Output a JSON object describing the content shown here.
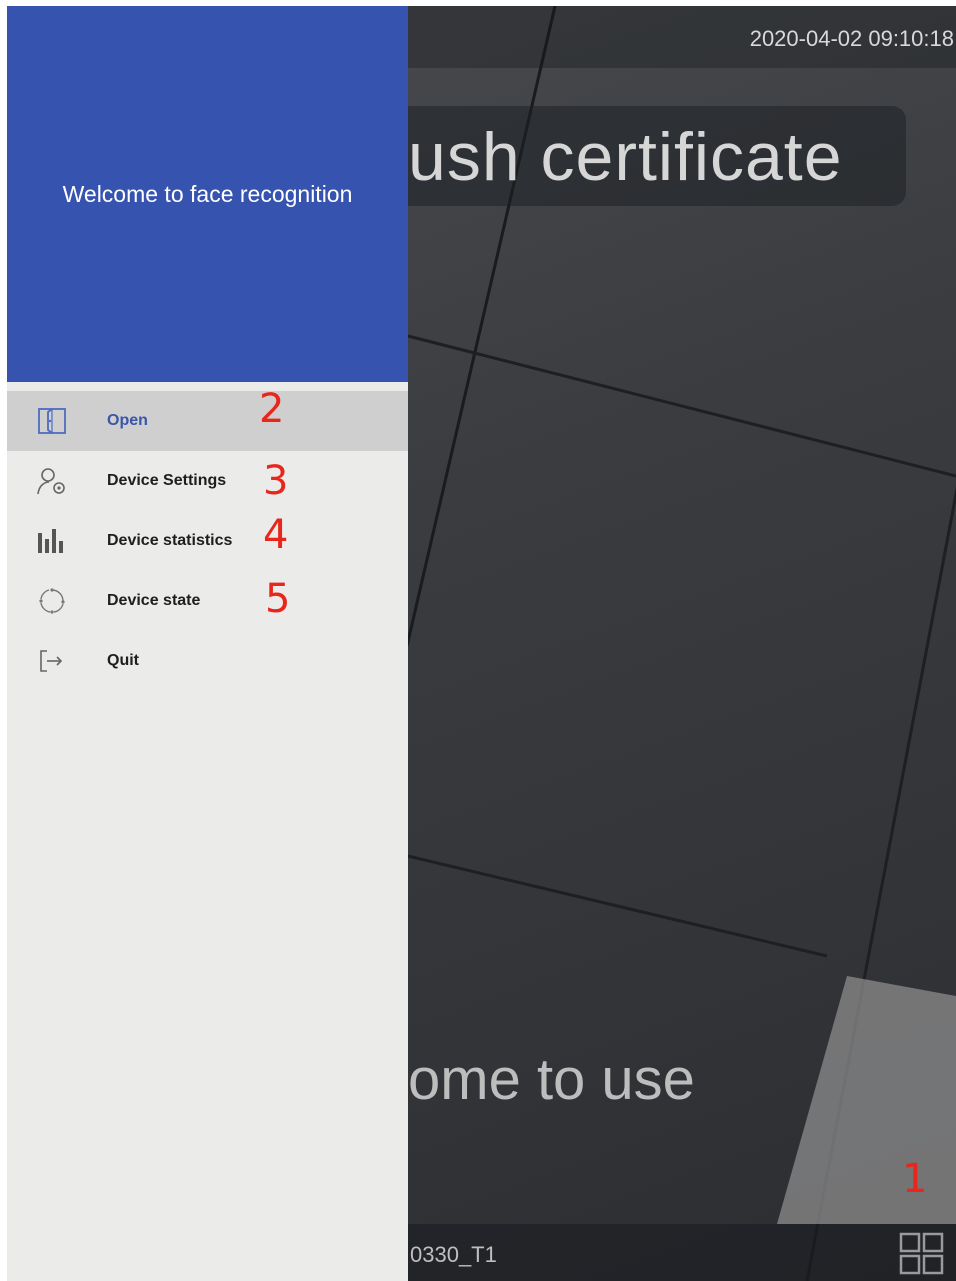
{
  "status": {
    "datetime": "2020-04-02 09:10:18"
  },
  "camera": {
    "banner_text": "ush certificate",
    "welcome_text": "ome to use",
    "device_id": "0330_T1",
    "grid_icon": "grid-icon"
  },
  "drawer": {
    "title": "Welcome to face recognition",
    "items": [
      {
        "label": "Open",
        "icon": "door-icon",
        "active": true
      },
      {
        "label": "Device Settings",
        "icon": "user-settings-icon"
      },
      {
        "label": "Device statistics",
        "icon": "bar-chart-icon"
      },
      {
        "label": "Device state",
        "icon": "state-cycle-icon"
      },
      {
        "label": "Quit",
        "icon": "exit-icon"
      }
    ]
  },
  "annotations": [
    "1",
    "2",
    "3",
    "4",
    "5"
  ],
  "colors": {
    "drawer_header": "#3653b0",
    "drawer_bg": "#ebebe9",
    "active_item_bg": "#cfcfcf",
    "active_label": "#3a56a8",
    "annotation": "#e8261c"
  }
}
